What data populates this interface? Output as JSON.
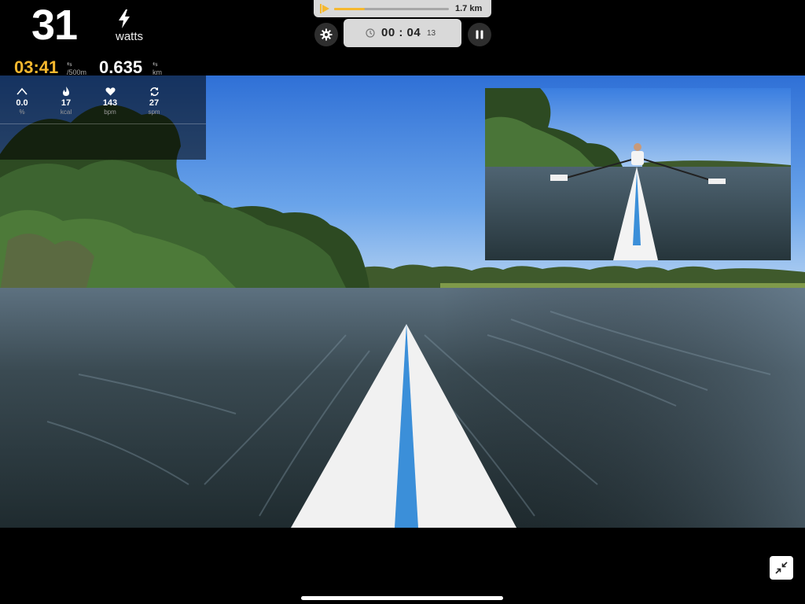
{
  "stats": {
    "power_value": "31",
    "power_unit": "watts",
    "split_value": "03:41",
    "split_unit": "/500m",
    "distance_value": "0.635",
    "distance_unit": "km"
  },
  "metrics": [
    {
      "icon": "incline-icon",
      "value": "0.0",
      "unit": "%"
    },
    {
      "icon": "flame-icon",
      "value": "17",
      "unit": "kcal"
    },
    {
      "icon": "heart-icon",
      "value": "143",
      "unit": "bpm"
    },
    {
      "icon": "refresh-icon",
      "value": "27",
      "unit": "spm"
    }
  ],
  "progress": {
    "total_label": "1.7 km",
    "fraction": 0.27
  },
  "timer": {
    "hours": "00",
    "minutes": "04",
    "hm_display": "00 : 04",
    "centis": "13"
  },
  "colors": {
    "accent": "#f5b82e",
    "boat_stripe": "#3b8fd9"
  }
}
